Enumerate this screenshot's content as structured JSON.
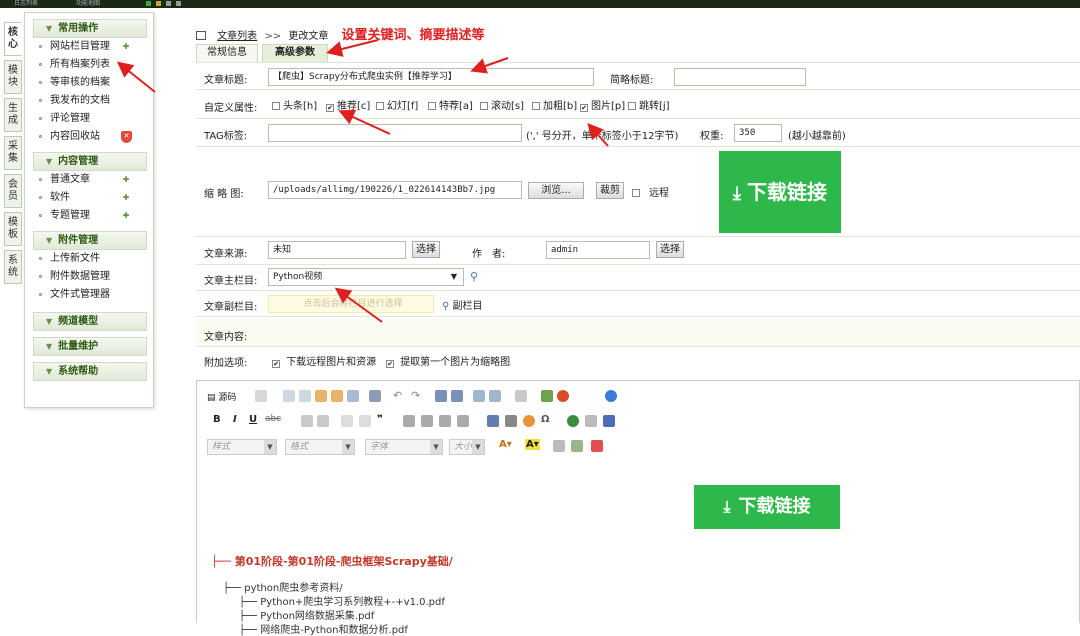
{
  "topbar": {
    "left1": "日志列表",
    "left2": "功能地图"
  },
  "vertical_tabs": [
    "核心",
    "模块",
    "生成",
    "采集",
    "会员",
    "模板",
    "系统"
  ],
  "sidebar": {
    "sections": [
      {
        "title": "常用操作",
        "items": [
          "网站栏目管理",
          "所有档案列表",
          "等审核的档案",
          "我发布的文档",
          "评论管理",
          "内容回收站"
        ]
      },
      {
        "title": "内容管理",
        "items": [
          "普通文章",
          "软件",
          "专题管理"
        ]
      },
      {
        "title": "附件管理",
        "items": [
          "上传新文件",
          "附件数据管理",
          "文件式管理器"
        ]
      },
      {
        "title": "频道模型",
        "items": []
      },
      {
        "title": "批量维护",
        "items": []
      },
      {
        "title": "系统帮助",
        "items": []
      }
    ]
  },
  "breadcrumb": {
    "link": "文章列表",
    "sep": ">>",
    "current": "更改文章"
  },
  "annotation": "设置关键词、摘要描述等",
  "tabs": [
    "常规信息",
    "高级参数"
  ],
  "form": {
    "title_label": "文章标题:",
    "title_value": "【爬虫】Scrapy分布式爬虫实例【推荐学习】",
    "short_title_label": "简略标题:",
    "custom_attr_label": "自定义属性:",
    "attrs": [
      {
        "label": "头条[h]",
        "checked": false
      },
      {
        "label": "推荐[c]",
        "checked": true
      },
      {
        "label": "幻灯[f]",
        "checked": false
      },
      {
        "label": "特荐[a]",
        "checked": false
      },
      {
        "label": "滚动[s]",
        "checked": false
      },
      {
        "label": "加粗[b]",
        "checked": false
      },
      {
        "label": "图片[p]",
        "checked": true
      },
      {
        "label": "跳转[j]",
        "checked": false
      }
    ],
    "tag_label": "TAG标签:",
    "tag_hint": "(',' 号分开，单个标签小于12字节)",
    "weight_label": "权重:",
    "weight_value": "350",
    "weight_hint": "(越小越靠前)",
    "thumb_label": "缩 略 图:",
    "thumb_value": "/uploads/allimg/190226/1_022614143Bb7.jpg",
    "browse_btn": "浏览...",
    "crop_btn": "裁剪",
    "remote_label": "远程",
    "source_label": "文章来源:",
    "source_value": "未知",
    "select_btn": "选择",
    "author_label": "作　者:",
    "author_value": "admin",
    "main_col_label": "文章主栏目:",
    "main_col_value": "Python视频",
    "sub_col_label": "文章副栏目:",
    "sub_col_placeholder": "点击后会将栏目进行选择",
    "sub_col_btn": "副栏目",
    "content_label": "文章内容:",
    "extra_label": "附加选项:",
    "extra1": "下载远程图片和资源",
    "extra2": "提取第一个图片为缩略图"
  },
  "download_label": "下载链接",
  "editor": {
    "source_btn": "源码",
    "combos": [
      "样式",
      "格式",
      "字体",
      "大小"
    ],
    "heading": "├── 第01阶段-第01阶段-爬虫框架Scrapy基础/",
    "tree": [
      "├── python爬虫参考资料/",
      "├── Python+爬虫学习系列教程+-+v1.0.pdf",
      "├── Python网络数据采集.pdf",
      "├── 网络爬虫-Python和数据分析.pdf"
    ]
  },
  "colors": {
    "accent_green": "#2eb84b",
    "annotation_red": "#e02020",
    "sidebar_title": "#2f5a12"
  }
}
